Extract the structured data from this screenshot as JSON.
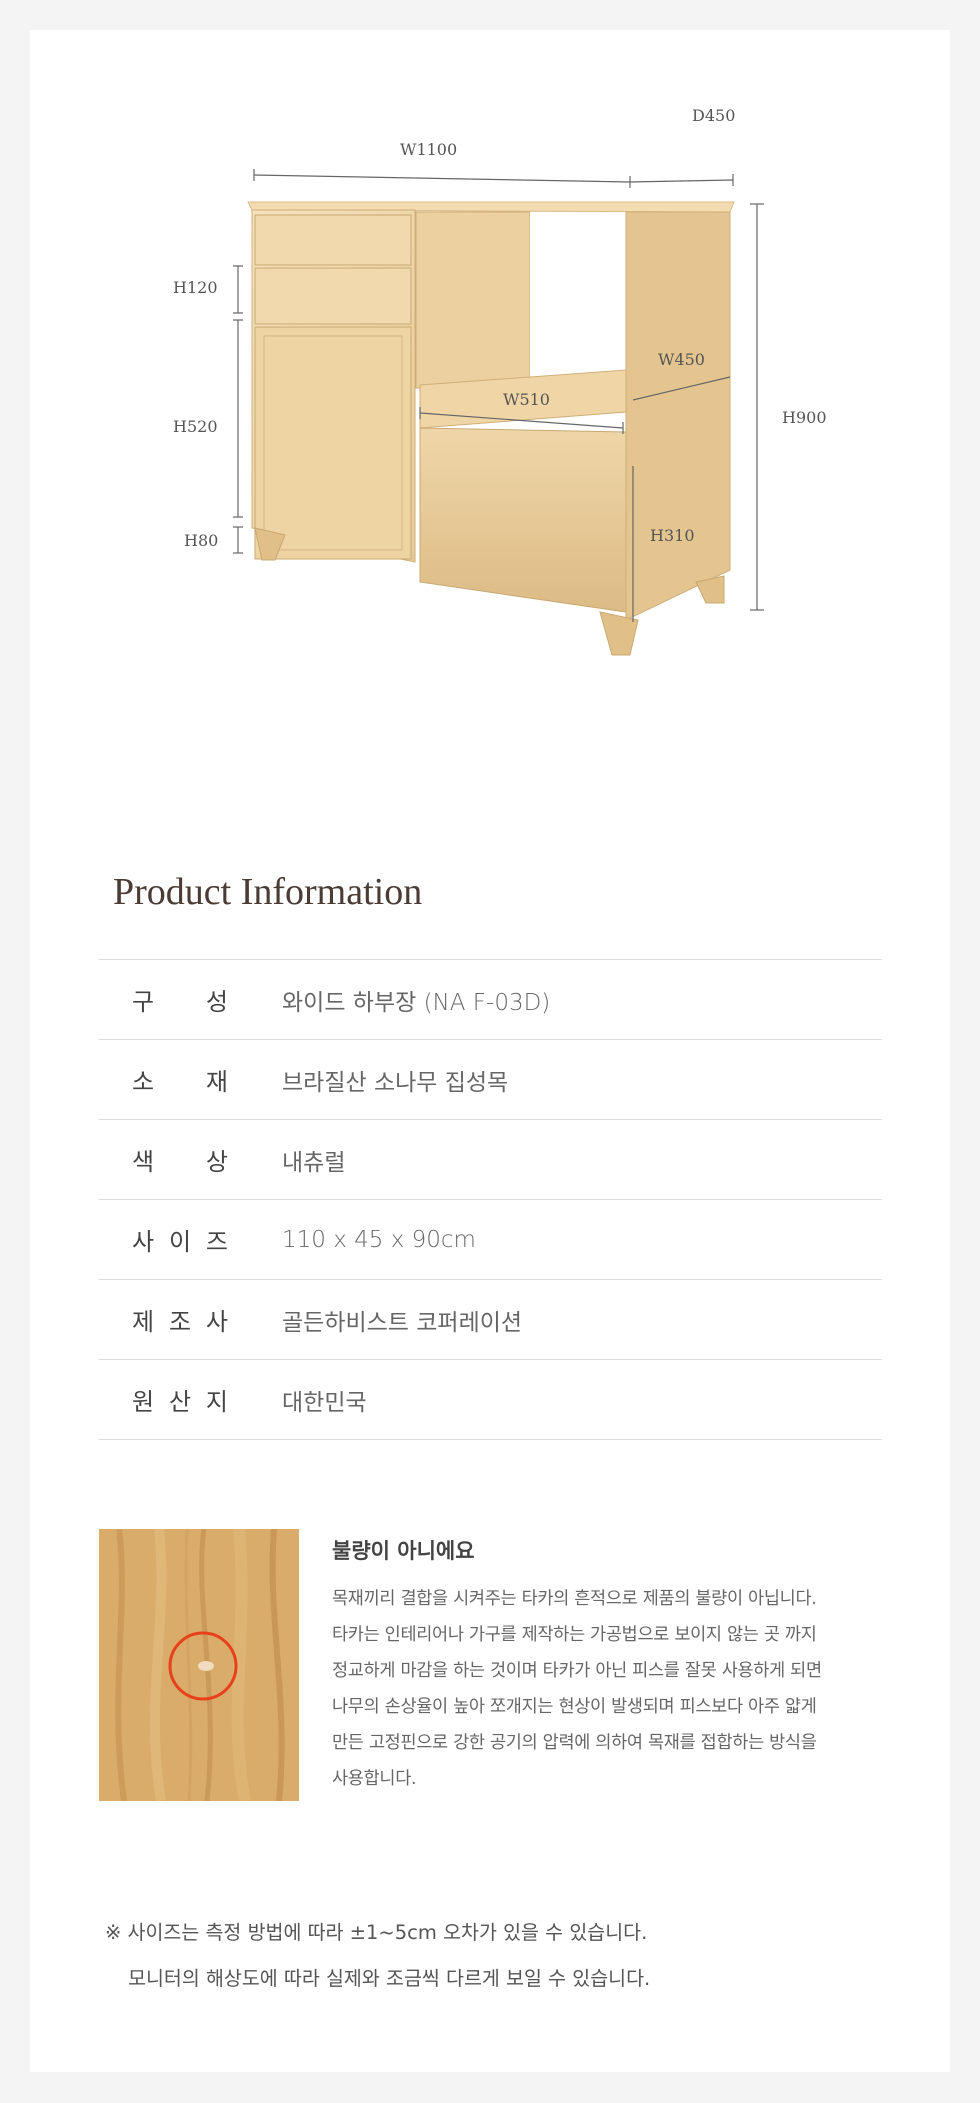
{
  "dimensions": {
    "width": "W1100",
    "depth": "D450",
    "height": "H900",
    "drawer_height": "H120",
    "door_height": "H520",
    "leg_height": "H80",
    "inner_width": "W510",
    "inner_depth": "W450",
    "bottom_drawer_height": "H310"
  },
  "product_info": {
    "title": "Product Information",
    "rows": [
      {
        "key": [
          "구",
          "성"
        ],
        "value": "와이드 하부장 (NA F-03D)"
      },
      {
        "key": [
          "소",
          "재"
        ],
        "value": "브라질산 소나무 집성목"
      },
      {
        "key": [
          "색",
          "상"
        ],
        "value": "내츄럴"
      },
      {
        "key": [
          "사",
          "이",
          "즈"
        ],
        "value": "110 x 45 x 90cm"
      },
      {
        "key": [
          "제",
          "조",
          "사"
        ],
        "value": "골든하비스트 코퍼레이션"
      },
      {
        "key": [
          "원",
          "산",
          "지"
        ],
        "value": "대한민국"
      }
    ]
  },
  "notice": {
    "title": "불량이 아니에요",
    "lines": [
      "목재끼리 결합을 시켜주는 타카의 흔적으로 제품의 불량이 아닙니다.",
      "타카는 인테리어나 가구를 제작하는 가공법으로 보이지 않는 곳 까지",
      "정교하게 마감을 하는 것이며 타카가 아닌 피스를 잘못 사용하게 되면",
      "나무의 손상율이 높아 쪼개지는 현상이 발생되며 피스보다 아주 얇게",
      "만든 고정핀으로 강한 공기의 압력에 의하여 목재를 접합하는 방식을",
      "사용합니다."
    ]
  },
  "footnote": {
    "line1": "※ 사이즈는 측정 방법에 따라 ±1~5cm 오차가 있을 수 있습니다.",
    "line2": "모니터의 해상도에 따라 실제와 조금씩 다르게 보일 수 있습니다."
  },
  "colors": {
    "wood_light": "#f2dcb4",
    "wood_mid": "#e8cb98",
    "wood_dark": "#d9b67e",
    "marker_red": "#e8401c"
  }
}
